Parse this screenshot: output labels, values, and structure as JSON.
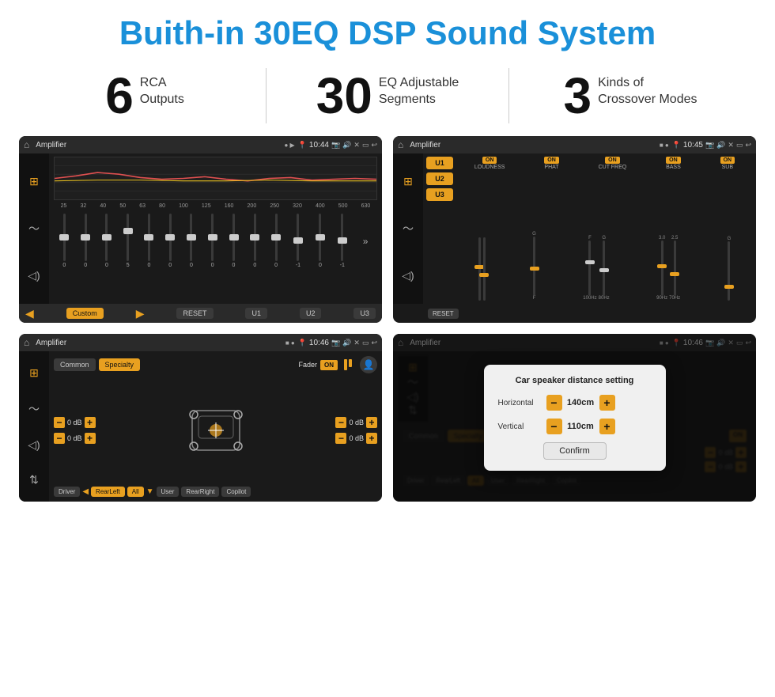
{
  "page": {
    "title": "Buith-in 30EQ DSP Sound System",
    "stats": [
      {
        "number": "6",
        "text": "RCA\nOutputs"
      },
      {
        "number": "30",
        "text": "EQ Adjustable\nSegments"
      },
      {
        "number": "3",
        "text": "Kinds of\nCrossover Modes"
      }
    ],
    "screens": [
      {
        "id": "eq-screen",
        "statusbar": {
          "app": "Amplifier",
          "time": "10:44"
        },
        "eq_freqs": [
          "25",
          "32",
          "40",
          "50",
          "63",
          "80",
          "100",
          "125",
          "160",
          "200",
          "250",
          "320",
          "400",
          "500",
          "630"
        ],
        "eq_values": [
          "0",
          "0",
          "0",
          "5",
          "0",
          "0",
          "0",
          "0",
          "0",
          "0",
          "0",
          "-1",
          "0",
          "-1"
        ],
        "nav_items": [
          "Custom",
          "RESET",
          "U1",
          "U2",
          "U3"
        ]
      },
      {
        "id": "amp2-screen",
        "statusbar": {
          "app": "Amplifier",
          "time": "10:45"
        },
        "presets": [
          "U1",
          "U2",
          "U3"
        ],
        "controls": [
          {
            "label": "LOUDNESS",
            "on": true
          },
          {
            "label": "PHAT",
            "on": true
          },
          {
            "label": "CUT FREQ",
            "on": true
          },
          {
            "label": "BASS",
            "on": true
          },
          {
            "label": "SUB",
            "on": true
          }
        ],
        "reset_label": "RESET"
      },
      {
        "id": "fader-screen",
        "statusbar": {
          "app": "Amplifier",
          "time": "10:46"
        },
        "mode_buttons": [
          "Common",
          "Specialty"
        ],
        "fader_label": "Fader",
        "fader_on": "ON",
        "db_rows": [
          {
            "value": "0 dB"
          },
          {
            "value": "0 dB"
          },
          {
            "value": "0 dB"
          },
          {
            "value": "0 dB"
          }
        ],
        "nav_items": [
          "Driver",
          "RearLeft",
          "All",
          "User",
          "RearRight",
          "Copilot"
        ]
      },
      {
        "id": "dist-screen",
        "statusbar": {
          "app": "Amplifier",
          "time": "10:46"
        },
        "mode_buttons": [
          "Common",
          "Specialty"
        ],
        "dialog": {
          "title": "Car speaker distance setting",
          "rows": [
            {
              "label": "Horizontal",
              "value": "140cm"
            },
            {
              "label": "Vertical",
              "value": "110cm"
            }
          ],
          "confirm_label": "Confirm"
        },
        "nav_items": [
          "Driver",
          "RearLeft",
          "All",
          "User",
          "RearRight",
          "Copilot"
        ]
      }
    ]
  }
}
